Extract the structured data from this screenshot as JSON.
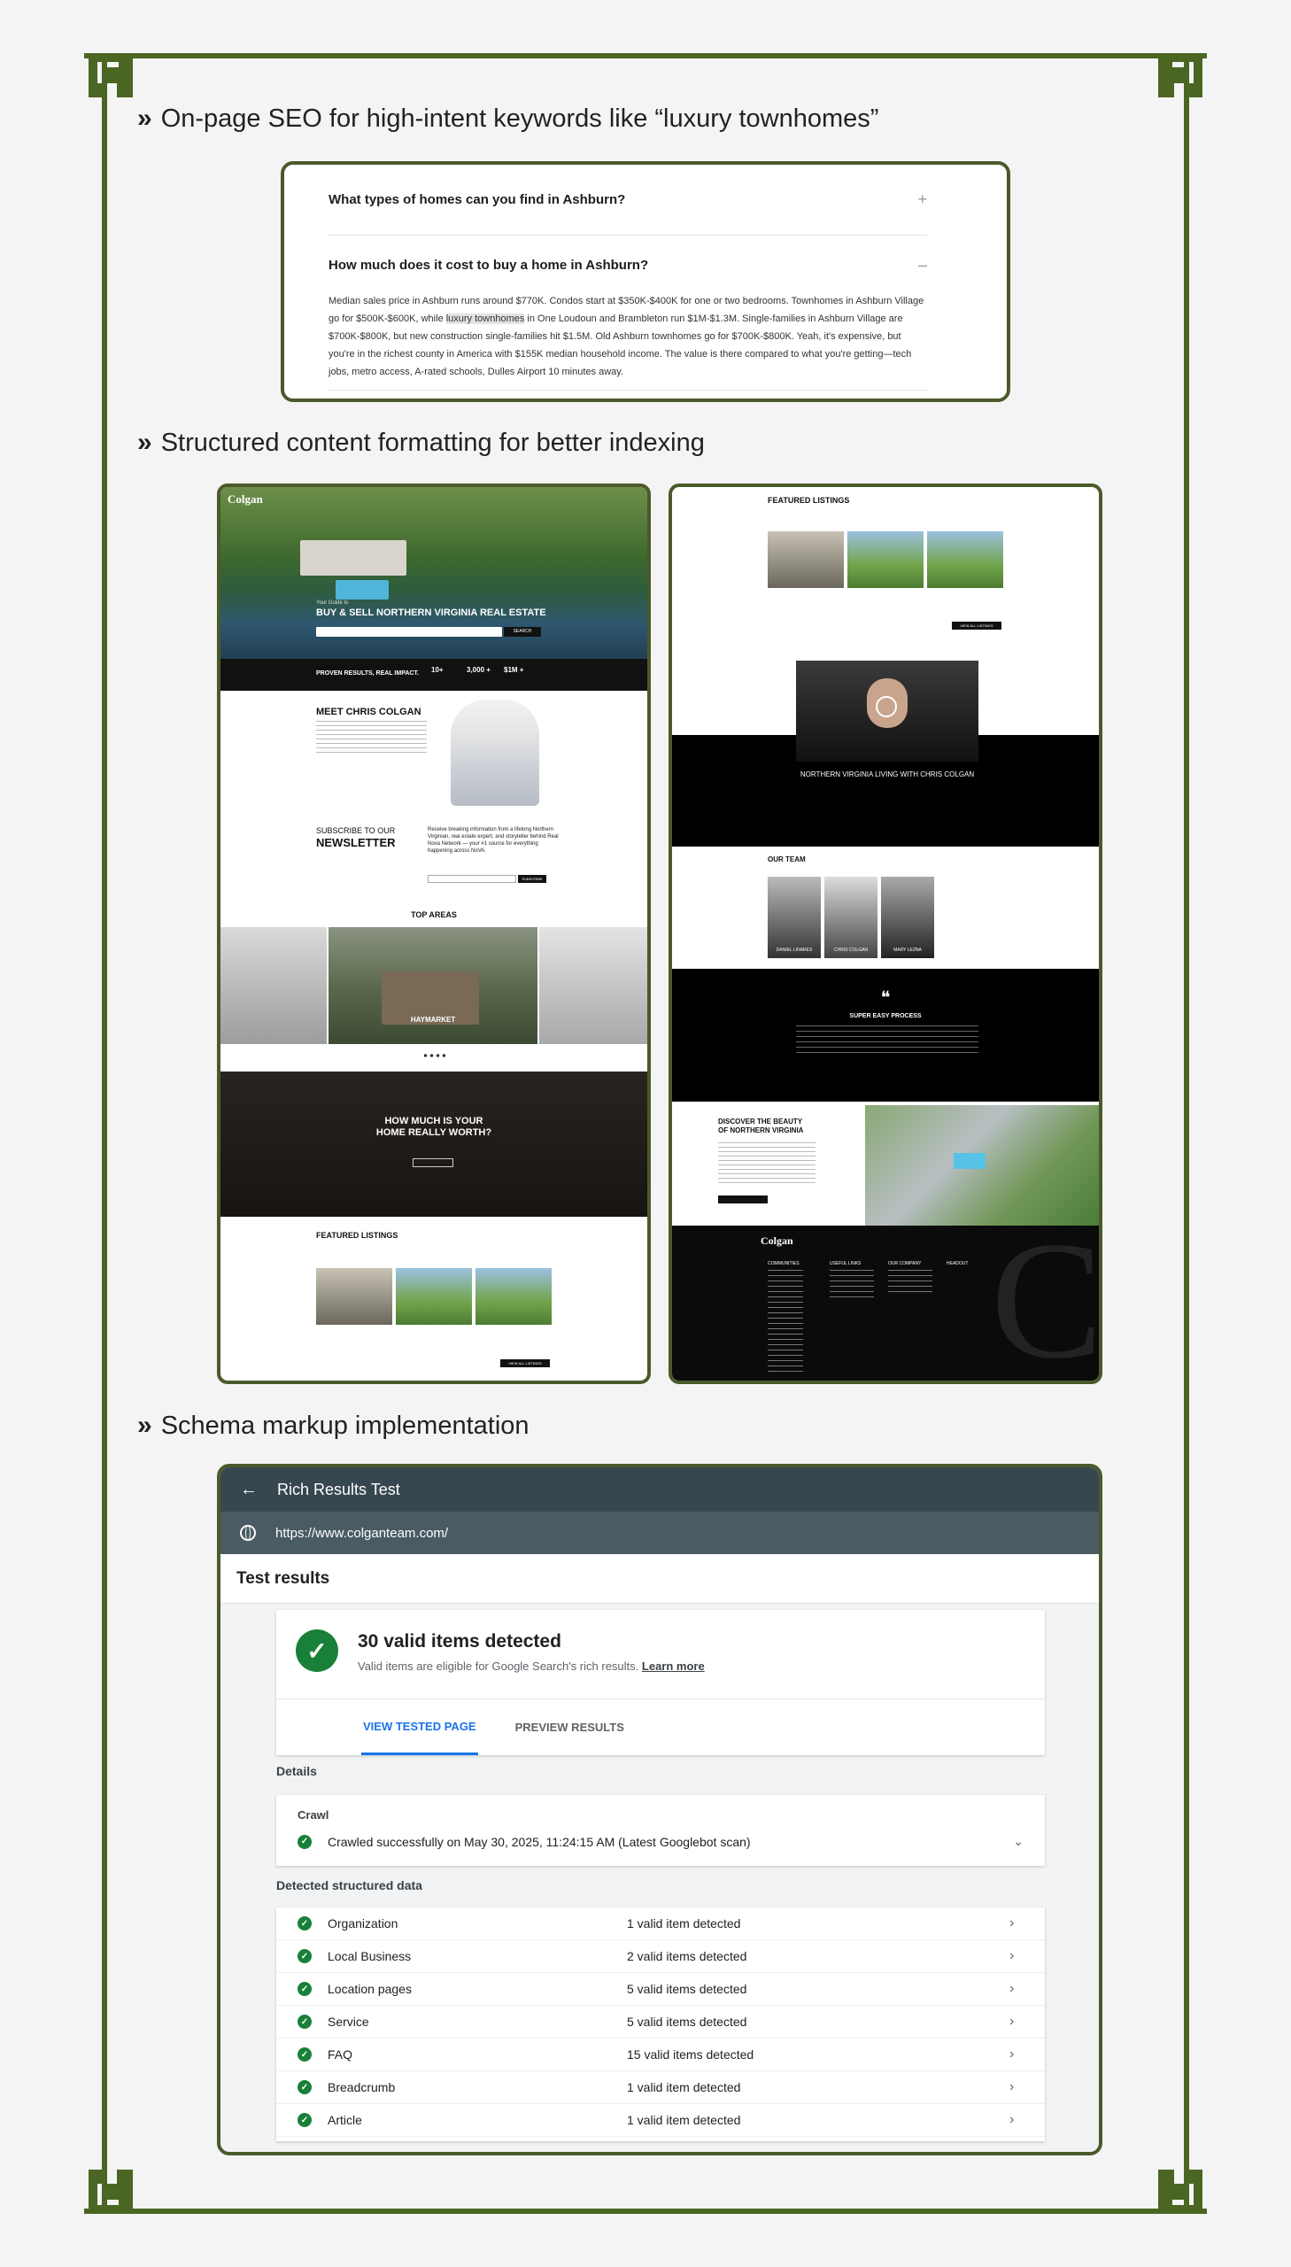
{
  "sections": {
    "seo_heading": "On-page SEO for high-intent keywords like “luxury townhomes”",
    "structured_heading": "Structured content formatting for better indexing",
    "schema_heading": "Schema markup implementation"
  },
  "faq": {
    "q1": "What types of homes can you find in Ashburn?",
    "q1_toggle": "+",
    "q2": "How much does it cost to buy a home in Ashburn?",
    "q2_toggle": "–",
    "answer_before": "Median sales price in Ashburn runs around $770K. Condos start at $350K-$400K for one or two bedrooms. Townhomes in Ashburn Village go for $500K-$600K, while ",
    "answer_highlight": "luxury townhomes",
    "answer_after": " in One Loudoun and Brambleton run $1M-$1.3M. Single-families in Ashburn Village are $700K-$800K, but new construction single-families hit $1.5M. Old Ashburn townhomes go for $700K-$800K. Yeah, it's expensive, but you're in the richest county in America with $155K median household income. The value is there compared to what you're getting—tech jobs, metro access, A-rated schools, Dulles Airport 10 minutes away."
  },
  "mock_left": {
    "logo": "Colgan",
    "hero_small": "Your Guide to",
    "hero_title": "BUY & SELL NORTHERN VIRGINIA REAL ESTATE",
    "search_btn": "SEARCH",
    "stats_label": "PROVEN RESULTS, REAL IMPACT.",
    "stat1": "10+",
    "stat2": "3,000 +",
    "stat3": "$1M +",
    "meet_title": "MEET CHRIS COLGAN",
    "subscribe_title1": "SUBSCRIBE TO OUR",
    "subscribe_title2": "NEWSLETTER",
    "subscribe_text": "Receive breaking information from a lifelong Northern Virginian, real estate expert, and storyteller behind Real Nova Network — your #1 source for everything happening across NoVA.",
    "subscribe_btn": "SUBSCRIBE",
    "top_areas": "TOP AREAS",
    "area_label": "HAYMARKET",
    "worth_title1": "HOW MUCH IS YOUR",
    "worth_title2": "HOME REALLY WORTH?",
    "featured": "FEATURED LISTINGS",
    "view_all": "VIEW ALL LISTINGS"
  },
  "mock_right": {
    "featured": "FEATURED LISTINGS",
    "view_all": "VIEW ALL LISTINGS",
    "video_title": "NORTHERN VIRGINIA LIVING WITH CHRIS COLGAN",
    "team_title": "OUR TEAM",
    "team1": "DANIEL LINARES",
    "team2": "CHRIS COLGAN",
    "team3": "MARY LEZNA",
    "quote_mark": "❝",
    "process_title": "SUPER EASY PROCESS",
    "discover_title1": "DISCOVER THE BEAUTY",
    "discover_title2": "OF NORTHERN VIRGINIA",
    "footer_logo": "Colgan",
    "footer_col1": "COMMUNITIES",
    "footer_col2": "USEFUL LINKS",
    "footer_col3": "OUR COMPANY",
    "footer_col4": "HEADOUT",
    "footer_big_letter": "C"
  },
  "rich_results": {
    "title": "Rich Results Test",
    "url": "https://www.colganteam.com/",
    "test_results": "Test results",
    "valid_title": "30 valid items detected",
    "valid_sub": "Valid items are eligible for Google Search's rich results.",
    "learn_more": "Learn more",
    "tab_view": "VIEW TESTED PAGE",
    "tab_preview": "PREVIEW RESULTS",
    "details_label": "Details",
    "crawl_label": "Crawl",
    "crawl_text": "Crawled successfully on May 30, 2025, 11:24:15 AM (Latest Googlebot scan)",
    "detected_label": "Detected structured data",
    "items": [
      {
        "name": "Organization",
        "count": "1 valid item detected"
      },
      {
        "name": "Local Business",
        "count": "2 valid items detected"
      },
      {
        "name": "Location pages",
        "count": "5 valid items detected"
      },
      {
        "name": "Service",
        "count": "5 valid items detected"
      },
      {
        "name": "FAQ",
        "count": "15 valid items detected"
      },
      {
        "name": "Breadcrumb",
        "count": "1 valid item detected"
      },
      {
        "name": "Article",
        "count": "1 valid item detected"
      }
    ]
  },
  "colors": {
    "frame": "#4a6622",
    "card_border": "#4a5a2a",
    "google_blue": "#1a73e8",
    "google_green": "#188038"
  }
}
